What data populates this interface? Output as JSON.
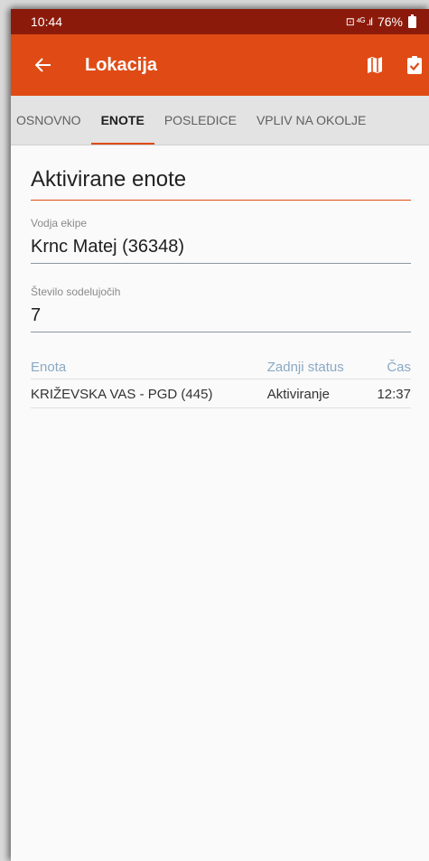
{
  "status_bar": {
    "time": "10:44",
    "signal_text": "⊡ ⁴ᴳ .ıl",
    "battery": "76%"
  },
  "app_bar": {
    "title": "Lokacija",
    "icons": [
      "back-arrow-icon",
      "map-icon",
      "clipboard-check-icon"
    ]
  },
  "tabs": [
    {
      "label": "OSNOVNO",
      "active": false
    },
    {
      "label": "ENOTE",
      "active": true
    },
    {
      "label": "POSLEDICE",
      "active": false
    },
    {
      "label": "VPLIV NA OKOLJE",
      "active": false
    }
  ],
  "section": {
    "title": "Aktivirane enote"
  },
  "fields": {
    "leader_label": "Vodja ekipe",
    "leader_value": "Krnc Matej (36348)",
    "participants_label": "Število sodelujočih",
    "participants_value": "7"
  },
  "table": {
    "headers": [
      "Enota",
      "Zadnji status",
      "Čas"
    ],
    "rows": [
      [
        "KRIŽEVSKA VAS - PGD (445)",
        "Aktiviranje",
        "12:37"
      ]
    ]
  },
  "colors": {
    "status_bar": "#8c1a0a",
    "app_bar": "#e04b15",
    "accent": "#e04b15",
    "table_header": "#8aa9c4"
  }
}
